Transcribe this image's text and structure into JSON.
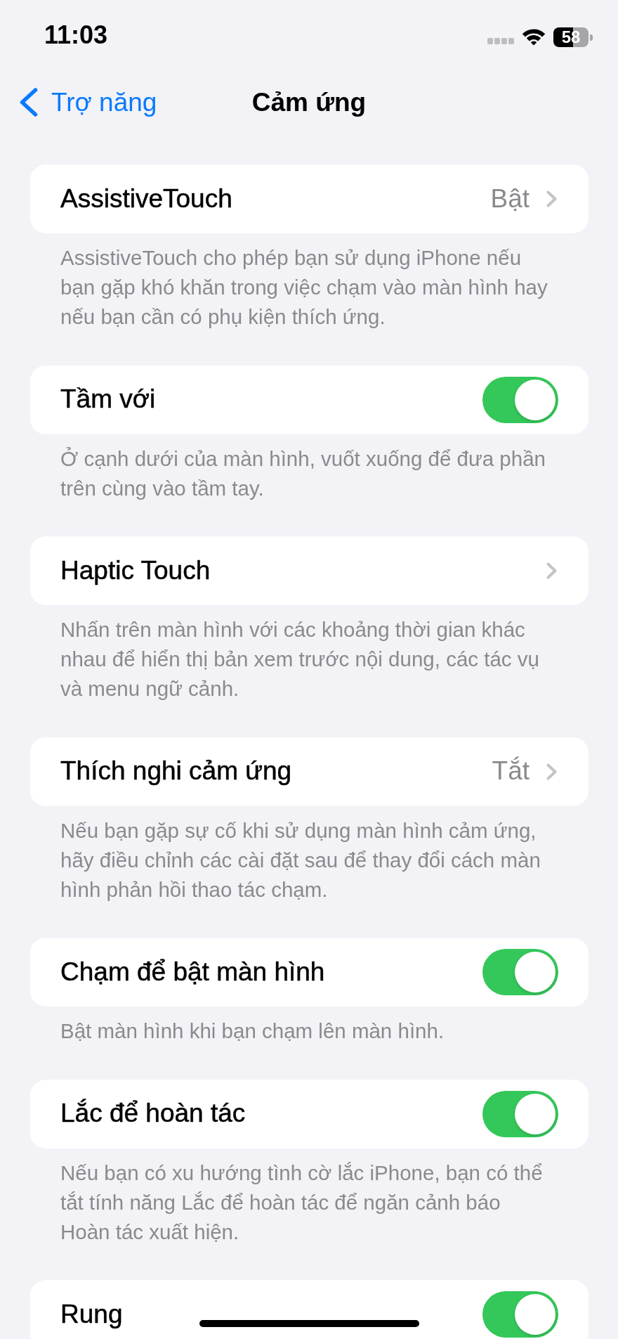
{
  "status_bar": {
    "time": "11:03",
    "battery": "58"
  },
  "nav": {
    "back_label": "Trợ năng",
    "title": "Cảm ứng"
  },
  "sections": [
    {
      "row": {
        "kind": "link",
        "label": "AssistiveTouch",
        "value": "Bật"
      },
      "footer": "AssistiveTouch cho phép bạn sử dụng iPhone nếu\nbạn gặp khó khăn trong việc chạm vào màn hình hay\nnếu bạn cần có phụ kiện thích ứng."
    },
    {
      "row": {
        "kind": "toggle",
        "label": "Tầm với",
        "on": true
      },
      "footer": "Ở cạnh dưới của màn hình, vuốt xuống để đưa phần\ntrên cùng vào tầm tay."
    },
    {
      "row": {
        "kind": "link",
        "label": "Haptic Touch"
      },
      "footer": "Nhấn trên màn hình với các khoảng thời gian khác\nnhau để hiển thị bản xem trước nội dung, các tác vụ\nvà menu ngữ cảnh."
    },
    {
      "row": {
        "kind": "link",
        "label": "Thích nghi cảm ứng",
        "value": "Tắt"
      },
      "footer": "Nếu bạn gặp sự cố khi sử dụng màn hình cảm ứng,\nhãy điều chỉnh các cài đặt sau để thay đổi cách màn\nhình phản hồi thao tác chạm."
    },
    {
      "row": {
        "kind": "toggle",
        "label": "Chạm để bật màn hình",
        "on": true
      },
      "footer": "Bật màn hình khi bạn chạm lên màn hình."
    },
    {
      "row": {
        "kind": "toggle",
        "label": "Lắc để hoàn tác",
        "on": true
      },
      "footer": "Nếu bạn có xu hướng tình cờ lắc iPhone, bạn có thể\ntắt tính năng Lắc để hoàn tác để ngăn cảnh báo\nHoàn tác xuất hiện."
    },
    {
      "row": {
        "kind": "toggle",
        "label": "Rung",
        "on": true
      }
    }
  ]
}
